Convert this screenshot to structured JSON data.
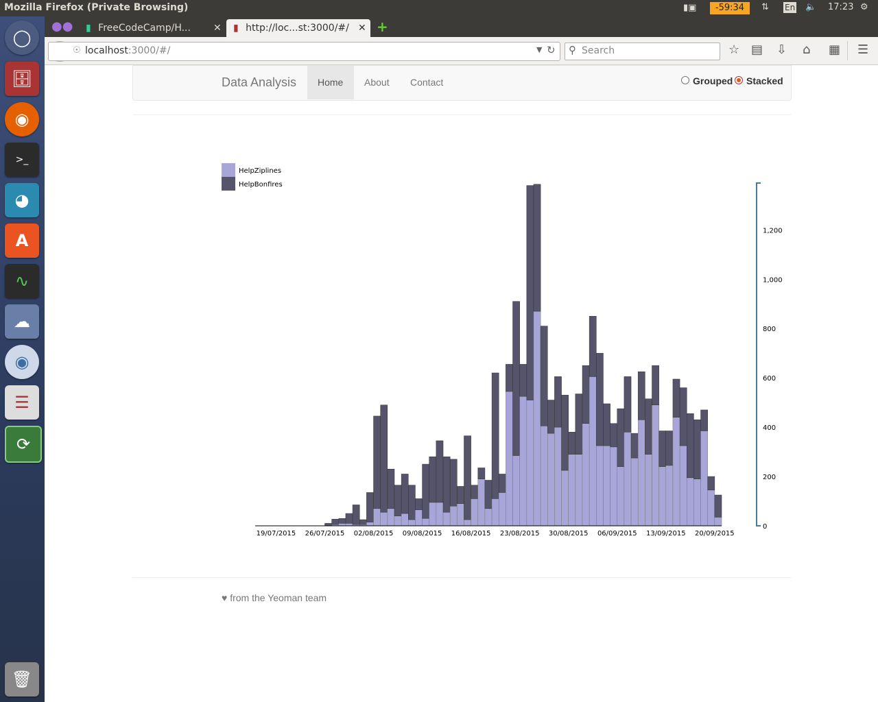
{
  "os": {
    "window_title": "Mozilla Firefox (Private Browsing)",
    "timer": "-59:34",
    "keyboard": "En",
    "clock": "17:23"
  },
  "browser": {
    "tabs": [
      {
        "label": "FreeCodeCamp/H...",
        "active": false
      },
      {
        "label": "http://loc...st:3000/#/",
        "active": true
      }
    ],
    "url_host": "localhost",
    "url_rest": ":3000/#/",
    "search_placeholder": "Search"
  },
  "page": {
    "brand": "Data Analysis",
    "nav": [
      "Home",
      "About",
      "Contact"
    ],
    "active_nav": "Home",
    "mode_options": [
      "Grouped",
      "Stacked"
    ],
    "mode_selected": "Stacked",
    "footer": "from the Yeoman team"
  },
  "colors": {
    "ziplines": "#a8a6d8",
    "bonfires": "#55546a",
    "axis": "#4a7a9a",
    "radio_selected": "#e95420"
  },
  "chart_data": {
    "type": "bar",
    "stacked": true,
    "series": [
      {
        "name": "HelpZiplines",
        "color": "#a8a6d8"
      },
      {
        "name": "HelpBonfires",
        "color": "#55546a"
      }
    ],
    "x_ticks": [
      "19/07/2015",
      "26/07/2015",
      "02/08/2015",
      "09/08/2015",
      "16/08/2015",
      "23/08/2015",
      "30/08/2015",
      "06/09/2015",
      "13/09/2015",
      "20/09/2015"
    ],
    "y_ticks": [
      0,
      200,
      400,
      600,
      800,
      1000,
      1200
    ],
    "ylim": [
      0,
      1390
    ],
    "y_axis_position": "right",
    "legend_position": "top-left",
    "days": [
      {
        "date": "16/07/2015",
        "ziplines": 0,
        "bonfires": 0
      },
      {
        "date": "17/07/2015",
        "ziplines": 0,
        "bonfires": 0
      },
      {
        "date": "18/07/2015",
        "ziplines": 0,
        "bonfires": 0
      },
      {
        "date": "19/07/2015",
        "ziplines": 0,
        "bonfires": 0
      },
      {
        "date": "20/07/2015",
        "ziplines": 0,
        "bonfires": 0
      },
      {
        "date": "21/07/2015",
        "ziplines": 0,
        "bonfires": 0
      },
      {
        "date": "22/07/2015",
        "ziplines": 0,
        "bonfires": 0
      },
      {
        "date": "23/07/2015",
        "ziplines": 0,
        "bonfires": 0
      },
      {
        "date": "24/07/2015",
        "ziplines": 0,
        "bonfires": 0
      },
      {
        "date": "25/07/2015",
        "ziplines": 0,
        "bonfires": 0
      },
      {
        "date": "26/07/2015",
        "ziplines": 0,
        "bonfires": 10
      },
      {
        "date": "27/07/2015",
        "ziplines": 5,
        "bonfires": 22
      },
      {
        "date": "28/07/2015",
        "ziplines": 10,
        "bonfires": 20
      },
      {
        "date": "29/07/2015",
        "ziplines": 10,
        "bonfires": 40
      },
      {
        "date": "30/07/2015",
        "ziplines": 5,
        "bonfires": 80
      },
      {
        "date": "31/07/2015",
        "ziplines": 5,
        "bonfires": 20
      },
      {
        "date": "01/08/2015",
        "ziplines": 15,
        "bonfires": 120
      },
      {
        "date": "02/08/2015",
        "ziplines": 70,
        "bonfires": 375
      },
      {
        "date": "03/08/2015",
        "ziplines": 55,
        "bonfires": 435
      },
      {
        "date": "04/08/2015",
        "ziplines": 70,
        "bonfires": 160
      },
      {
        "date": "05/08/2015",
        "ziplines": 40,
        "bonfires": 125
      },
      {
        "date": "06/08/2015",
        "ziplines": 50,
        "bonfires": 160
      },
      {
        "date": "07/08/2015",
        "ziplines": 25,
        "bonfires": 140
      },
      {
        "date": "08/08/2015",
        "ziplines": 65,
        "bonfires": 45
      },
      {
        "date": "09/08/2015",
        "ziplines": 30,
        "bonfires": 220
      },
      {
        "date": "10/08/2015",
        "ziplines": 95,
        "bonfires": 185
      },
      {
        "date": "11/08/2015",
        "ziplines": 95,
        "bonfires": 250
      },
      {
        "date": "12/08/2015",
        "ziplines": 55,
        "bonfires": 225
      },
      {
        "date": "13/08/2015",
        "ziplines": 80,
        "bonfires": 190
      },
      {
        "date": "14/08/2015",
        "ziplines": 90,
        "bonfires": 70
      },
      {
        "date": "15/08/2015",
        "ziplines": 25,
        "bonfires": 340
      },
      {
        "date": "16/08/2015",
        "ziplines": 110,
        "bonfires": 55
      },
      {
        "date": "17/08/2015",
        "ziplines": 190,
        "bonfires": 45
      },
      {
        "date": "18/08/2015",
        "ziplines": 70,
        "bonfires": 115
      },
      {
        "date": "19/08/2015",
        "ziplines": 110,
        "bonfires": 510
      },
      {
        "date": "20/08/2015",
        "ziplines": 135,
        "bonfires": 75
      },
      {
        "date": "21/08/2015",
        "ziplines": 545,
        "bonfires": 110
      },
      {
        "date": "22/08/2015",
        "ziplines": 285,
        "bonfires": 625
      },
      {
        "date": "23/08/2015",
        "ziplines": 525,
        "bonfires": 130
      },
      {
        "date": "24/08/2015",
        "ziplines": 510,
        "bonfires": 870
      },
      {
        "date": "25/08/2015",
        "ziplines": 870,
        "bonfires": 515
      },
      {
        "date": "26/08/2015",
        "ziplines": 405,
        "bonfires": 405
      },
      {
        "date": "27/08/2015",
        "ziplines": 375,
        "bonfires": 135
      },
      {
        "date": "28/08/2015",
        "ziplines": 400,
        "bonfires": 205
      },
      {
        "date": "29/08/2015",
        "ziplines": 225,
        "bonfires": 305
      },
      {
        "date": "30/08/2015",
        "ziplines": 290,
        "bonfires": 90
      },
      {
        "date": "31/08/2015",
        "ziplines": 290,
        "bonfires": 245
      },
      {
        "date": "01/09/2015",
        "ziplines": 415,
        "bonfires": 235
      },
      {
        "date": "02/09/2015",
        "ziplines": 605,
        "bonfires": 245
      },
      {
        "date": "03/09/2015",
        "ziplines": 325,
        "bonfires": 375
      },
      {
        "date": "04/09/2015",
        "ziplines": 325,
        "bonfires": 170
      },
      {
        "date": "05/09/2015",
        "ziplines": 320,
        "bonfires": 95
      },
      {
        "date": "06/09/2015",
        "ziplines": 240,
        "bonfires": 235
      },
      {
        "date": "07/09/2015",
        "ziplines": 380,
        "bonfires": 225
      },
      {
        "date": "08/09/2015",
        "ziplines": 275,
        "bonfires": 100
      },
      {
        "date": "09/09/2015",
        "ziplines": 430,
        "bonfires": 195
      },
      {
        "date": "10/09/2015",
        "ziplines": 290,
        "bonfires": 225
      },
      {
        "date": "11/09/2015",
        "ziplines": 490,
        "bonfires": 160
      },
      {
        "date": "12/09/2015",
        "ziplines": 240,
        "bonfires": 145
      },
      {
        "date": "13/09/2015",
        "ziplines": 245,
        "bonfires": 140
      },
      {
        "date": "14/09/2015",
        "ziplines": 440,
        "bonfires": 155
      },
      {
        "date": "15/09/2015",
        "ziplines": 325,
        "bonfires": 235
      },
      {
        "date": "16/09/2015",
        "ziplines": 195,
        "bonfires": 260
      },
      {
        "date": "17/09/2015",
        "ziplines": 190,
        "bonfires": 240
      },
      {
        "date": "18/09/2015",
        "ziplines": 385,
        "bonfires": 85
      },
      {
        "date": "19/09/2015",
        "ziplines": 145,
        "bonfires": 55
      },
      {
        "date": "20/09/2015",
        "ziplines": 35,
        "bonfires": 90
      }
    ]
  }
}
